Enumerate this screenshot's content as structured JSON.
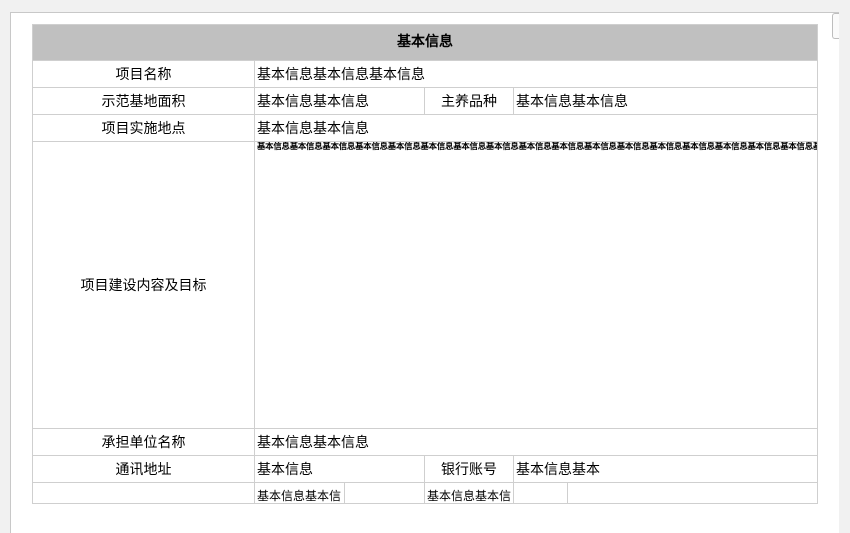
{
  "title": "基本信息",
  "rows": {
    "project_name": {
      "label": "项目名称",
      "value": "基本信息基本信息基本信息"
    },
    "area": {
      "label": "示范基地面积",
      "value": "基本信息基本信息",
      "label2": "主养品种",
      "value2": "基本信息基本信息"
    },
    "location": {
      "label": "项目实施地点",
      "value": "基本信息基本信息"
    },
    "content": {
      "label": "项目建设内容及目标",
      "value": "基本信息基本信息基本信息基本信息基本信息基本信息基本信息基本信息基本信息基本信息基本信息基本信息基本信息基本信息基本信息基本信息基本信息基本信息基本信息基本信息基本信息基本信息基本信息基本信息基本信息基本信息基本信息基本信息基本信息基本信息基本信息基本信息基本信息基本信息基本信息基本信息基本信息基本信息基本信息基本信息基本信息基本信息基本信息基本信息基本信息基本信息基本信息基本信息基本信息基本信息基本信息基本信息基本信息基本信息基本信息基本信息基本信息基本信息基本信息基本信息基本信息基本信息基本信息基本信息基本信息基本信息基本信息基本信息基本信息基本信息基本信息基本信息基本信息基本信息基本信息基本信息基本信息"
    },
    "unit": {
      "label": "承担单位名称",
      "value": "基本信息基本信息"
    },
    "address": {
      "label": "通讯地址",
      "value": "基本信息",
      "label2": "银行账号",
      "value2": "基本信息基本"
    },
    "partial": {
      "value": "基本信息基本信",
      "value2": "基本信息基本信"
    }
  },
  "colors": {
    "title_bg": "#c0c0c0",
    "border": "#cfcfcf",
    "page_bg": "#f1f1f1"
  }
}
